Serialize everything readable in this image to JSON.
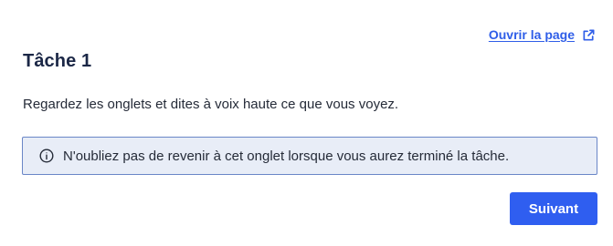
{
  "header": {
    "open_page_label": "Ouvrir la page",
    "open_page_icon": "external-link-icon"
  },
  "task": {
    "title": "Tâche 1",
    "instruction": "Regardez les onglets et dites à voix haute ce que vous voyez.",
    "info_icon": "info-icon",
    "info_text": "N'oubliez pas de revenir à cet onglet lorsque vous aurez terminé la tâche."
  },
  "actions": {
    "next_label": "Suivant"
  },
  "colors": {
    "accent": "#2f5ef0",
    "info_bg": "#e8edf7",
    "info_border": "#6a86c7",
    "title": "#1b2746"
  }
}
